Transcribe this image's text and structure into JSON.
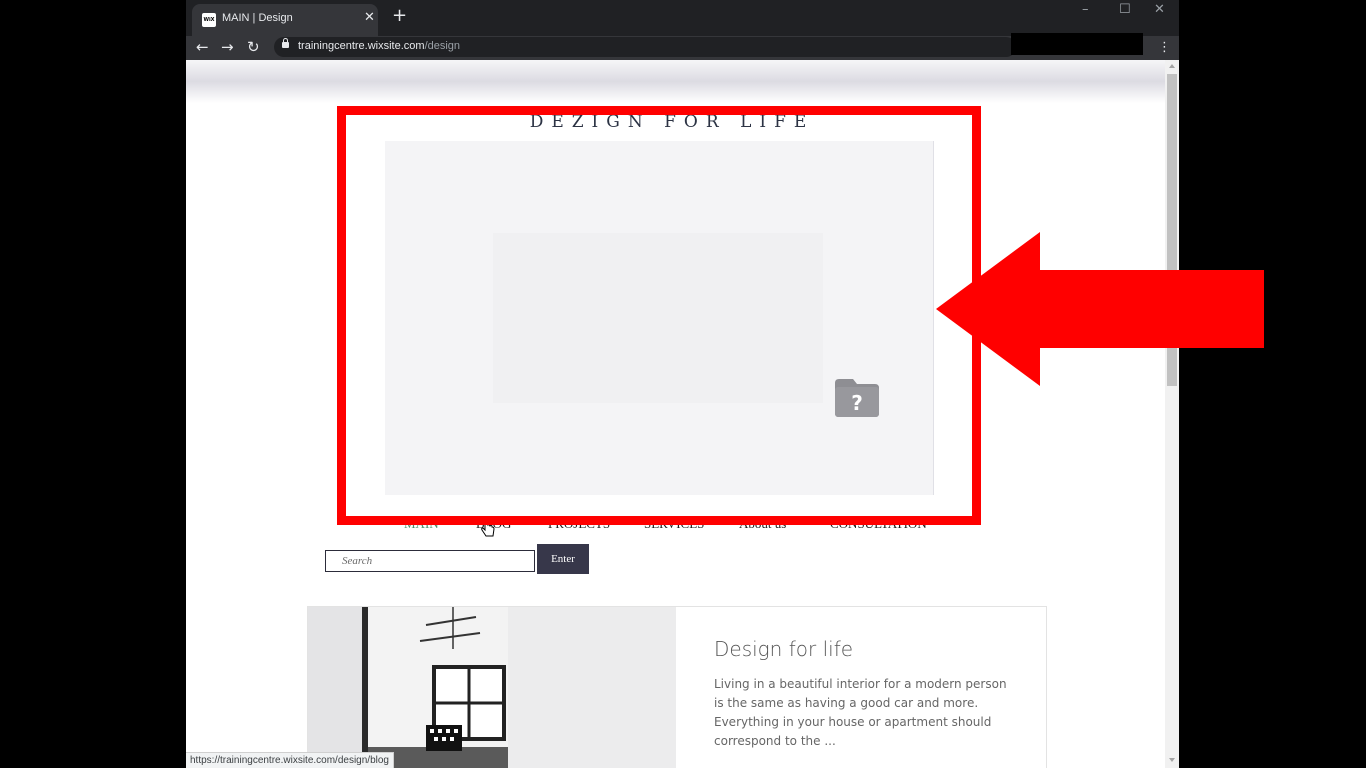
{
  "browser": {
    "tab_title": "MAIN | Design",
    "favicon_text": "WiX",
    "new_tab": "+",
    "url_host": "trainingcentre.wixsite.com",
    "url_path": "/design",
    "status_url": "https://trainingcentre.wixsite.com/design/blog"
  },
  "site": {
    "title": "DEZIGN FOR LIFE",
    "gallery_status": "broken-image-icon"
  },
  "menu": {
    "items": [
      {
        "label": "MAIN",
        "active": true
      },
      {
        "label": "BLOG",
        "active": false
      },
      {
        "label": "PROJECTS",
        "active": false
      },
      {
        "label": "SERVICES",
        "active": false
      },
      {
        "label": "About us",
        "active": false
      },
      {
        "label": "CONSULTATION",
        "active": false
      }
    ]
  },
  "search": {
    "placeholder": "Search",
    "button_label": "Enter"
  },
  "post": {
    "title": "Design for life",
    "excerpt": "Living in a beautiful interior for a modern person is the same as having a good car and more. Everything in your house or apartment should correspond to the ..."
  },
  "annotation": {
    "highlight_color": "#ff0000"
  },
  "colors": {
    "menu_active": "#4a8c6a",
    "button_bg": "#37374a",
    "title_text": "#2c3344"
  }
}
